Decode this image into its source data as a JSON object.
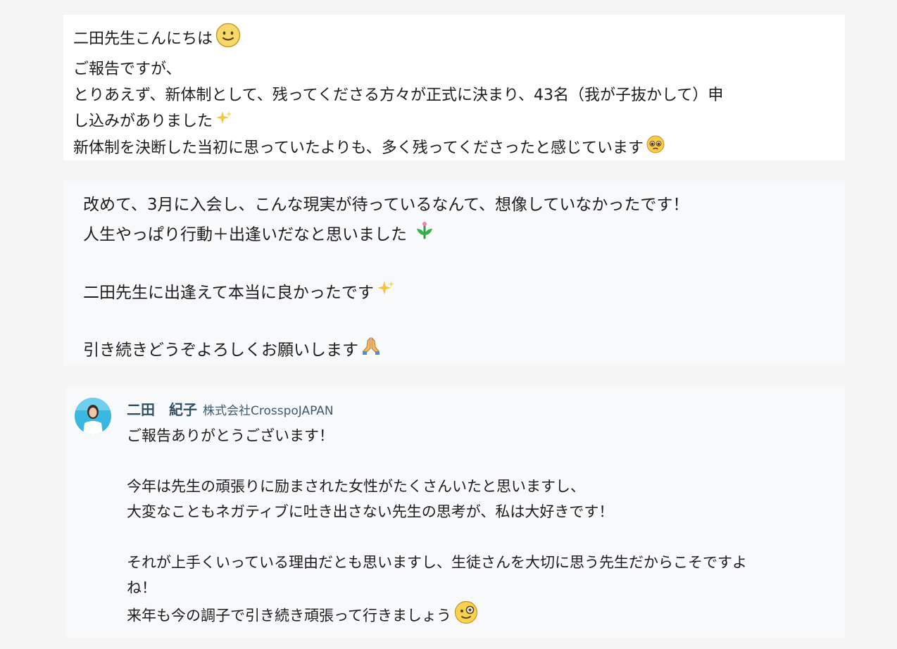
{
  "message1": {
    "lines": [
      "二田先生こんにちは",
      "ご報告ですが、",
      "とりあえず、新体制として、残ってくださる方々が正式に決まり、43名（我が子抜かして）申",
      "し込みがありました",
      "新体制を決断した当初に思っていたよりも、多く残ってくださったと感じています"
    ],
    "icons": [
      "slightly-smiling-face-icon",
      "sparkles-icon",
      "pleading-face-icon"
    ]
  },
  "message2": {
    "lines": [
      "改めて、3月に入会し、こんな現実が待っているなんて、想像していなかったです！",
      "人生やっぱり行動＋出逢いだなと思いました",
      "二田先生に出逢えて本当に良かったです",
      "引き続きどうぞよろしくお願いします"
    ],
    "icons": [
      "seedling-flower-icon",
      "sparkles-icon",
      "folded-hands-icon"
    ]
  },
  "reply": {
    "author": "二田　紀子",
    "company": "株式会社CrosspoJAPAN",
    "lines": [
      "ご報告ありがとうございます！",
      "今年は先生の頑張りに励まされた女性がたくさんいたと思いますし、",
      "大変なこともネガティブに吐き出さない先生の思考が、私は大好きです！",
      "それが上手くいっている理由だとも思いますし、生徒さんを大切に思う先生だからこそですよ",
      "ね！",
      "来年も今の調子で引き続き頑張って行きましょう"
    ],
    "icons": [
      "avatar-photo",
      "face-with-monocle-icon"
    ]
  },
  "colors": {
    "page_bg": "#f5f5f6",
    "author_name": "#2f4f63",
    "company": "#3f5a6e",
    "text": "#1d1c1d"
  }
}
